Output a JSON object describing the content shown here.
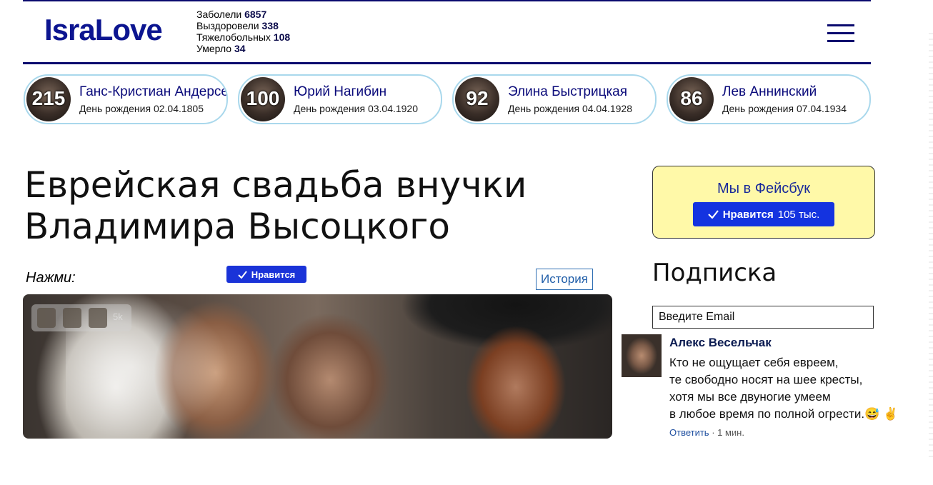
{
  "header": {
    "logo": "IsraLove",
    "stats": [
      {
        "label": "Заболели",
        "value": "6857"
      },
      {
        "label": "Выздоровели",
        "value": "338"
      },
      {
        "label": "Тяжелобольных",
        "value": "108"
      },
      {
        "label": "Умерло",
        "value": "34"
      }
    ],
    "menu_icon": "hamburger-icon"
  },
  "birthdays": [
    {
      "years": "215",
      "name": "Ганс-Кристиан Андерсен",
      "date": "День рождения 02.04.1805"
    },
    {
      "years": "100",
      "name": "Юрий Нагибин",
      "date": "День рождения 03.04.1920"
    },
    {
      "years": "92",
      "name": "Элина Быстрицкая",
      "date": "День рождения 04.04.1928"
    },
    {
      "years": "86",
      "name": "Лев Аннинский",
      "date": "День рождения 07.04.1934"
    }
  ],
  "article": {
    "title": "Еврейская свадьба внучки Владимира Высоцкого",
    "press_label": "Нажми:",
    "like_button": "Нравится",
    "history_button": "История",
    "share_count": "5k"
  },
  "sidebar": {
    "facebook_title": "Мы в Фейсбук",
    "facebook_like": "Нравится",
    "facebook_count": "105 тыс.",
    "subscribe_title": "Подписка",
    "email_placeholder": "Введите Email"
  },
  "comment": {
    "author": "Алекс Весельчак",
    "text": "Кто не ощущает себя евреем,\nте свободно носят на шее кресты,\nхотя мы все двуногие умеем\nв любое время по полной огрести.😅 ✌",
    "reply": "Ответить",
    "time": "· 1 мин."
  }
}
